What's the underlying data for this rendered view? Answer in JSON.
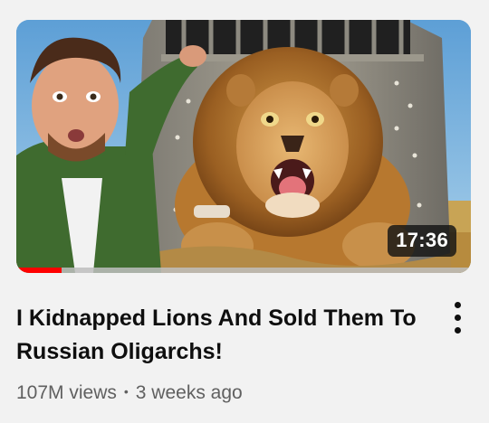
{
  "video": {
    "duration": "17:36",
    "title": "I Kidnapped Lions And Sold Them To Russian Oligarchs!",
    "views": "107M views",
    "separator": "•",
    "uploaded": "3 weeks ago",
    "watch_progress": 0.1
  },
  "colors": {
    "progress": "#ff0000",
    "title": "#0f0f0f",
    "meta": "#606060",
    "background": "#f2f2f2"
  },
  "icons": {
    "menu": "more-vertical-icon"
  }
}
